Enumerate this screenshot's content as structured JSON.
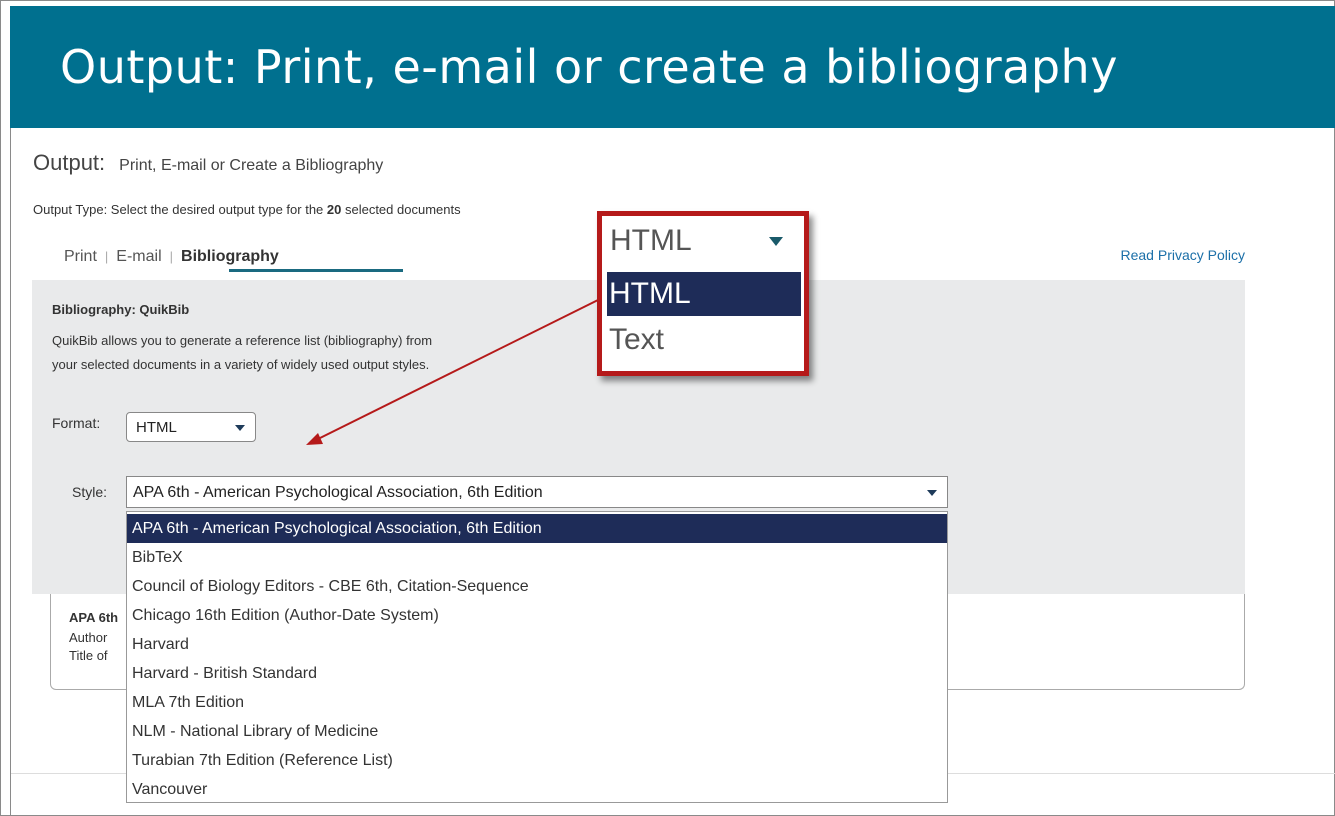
{
  "slide": {
    "title": "Output: Print, e-mail or create a bibliography"
  },
  "output": {
    "heading": "Output:",
    "subheading": "Print, E-mail or Create a Bibliography",
    "type_prefix": "Output Type: Select the desired output type for the ",
    "type_count": "20",
    "type_suffix": " selected documents"
  },
  "tabs": [
    {
      "label": "Print",
      "active": false
    },
    {
      "label": "E-mail",
      "active": false
    },
    {
      "label": "Bibliography",
      "active": true
    }
  ],
  "privacy_link": "Read Privacy Policy",
  "bibliography": {
    "heading": "Bibliography: QuikBib",
    "description_line1": "QuikBib allows you to generate a reference list (bibliography) from",
    "description_line2": "your selected documents in a variety of widely used output styles.",
    "format_label": "Format:",
    "format_value": "HTML",
    "style_label": "Style:",
    "style_value": "APA 6th - American Psychological Association, 6th Edition",
    "style_options": [
      "APA 6th - American Psychological Association, 6th Edition",
      "BibTeX",
      "Council of Biology Editors - CBE 6th, Citation-Sequence",
      "Chicago 16th Edition (Author-Date System)",
      "Harvard",
      "Harvard - British Standard",
      "MLA 7th Edition",
      "NLM - National Library of Medicine",
      "Turabian 7th Edition (Reference List)",
      "Vancouver"
    ],
    "selected_style_index": 0
  },
  "preview": {
    "line1": "APA 6th",
    "line2": "Author",
    "line3": "Title of"
  },
  "callout": {
    "current_value": "HTML",
    "options": [
      "HTML",
      "Text"
    ],
    "selected_index": 0
  },
  "colors": {
    "banner": "#00708f",
    "callout_border": "#b51a1a",
    "selection": "#1e2c58",
    "arrow": "#b51a1a"
  },
  "icons": {
    "dropdown": "caret-down-icon",
    "callout_pointer": "arrow-icon"
  }
}
